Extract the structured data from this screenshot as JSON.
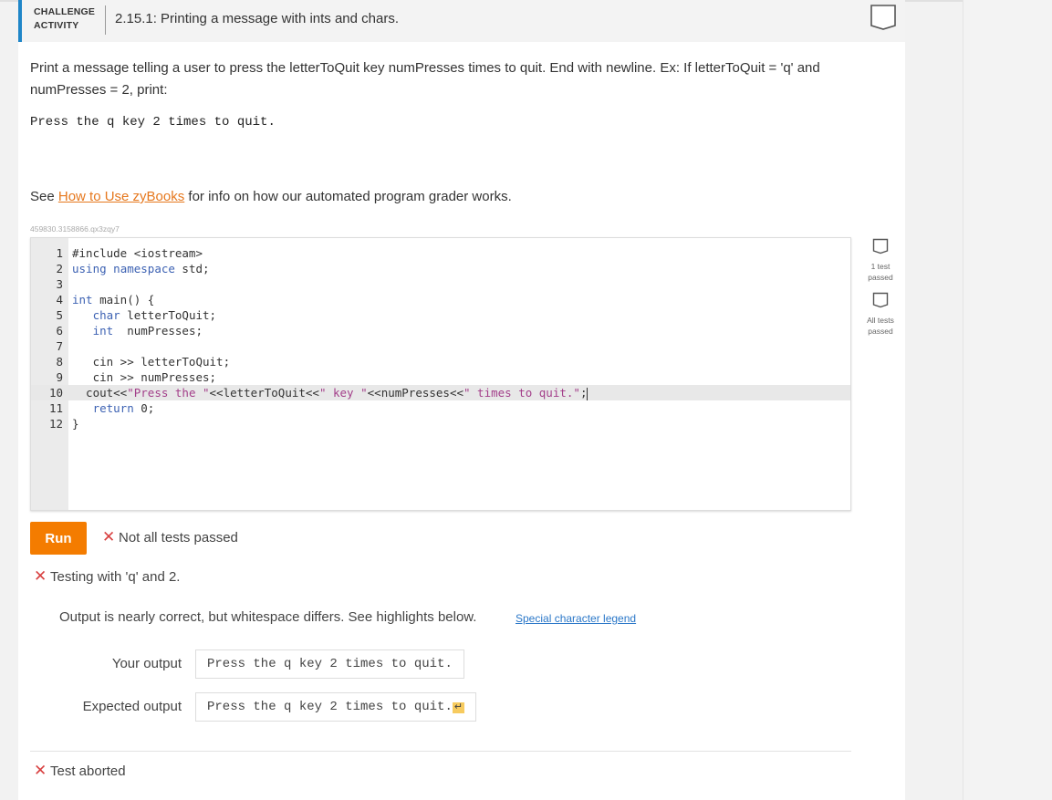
{
  "header": {
    "label_line1": "CHALLENGE",
    "label_line2": "ACTIVITY",
    "title": "2.15.1: Printing a message with ints and chars."
  },
  "prompt": {
    "text_line1": "Print a message telling a user to press the letterToQuit key numPresses times to quit. End with newline. Ex: If letterToQuit = 'q' and",
    "text_line2": "numPresses = 2, print:",
    "example_output": "Press the q key 2 times to quit."
  },
  "help": {
    "prefix": "See ",
    "link_text": "How to Use zyBooks",
    "suffix": " for info on how our automated program grader works."
  },
  "meta_id": "459830.3158866.qx3zqy7",
  "editor": {
    "lines": [
      {
        "n": "1",
        "code": "#include <iostream>"
      },
      {
        "n": "2",
        "code": "using namespace std;"
      },
      {
        "n": "3",
        "code": ""
      },
      {
        "n": "4",
        "code": "int main() {"
      },
      {
        "n": "5",
        "code": "   char letterToQuit;"
      },
      {
        "n": "6",
        "code": "   int  numPresses;"
      },
      {
        "n": "7",
        "code": ""
      },
      {
        "n": "8",
        "code": "   cin >> letterToQuit;"
      },
      {
        "n": "9",
        "code": "   cin >> numPresses;"
      },
      {
        "n": "10",
        "code": "  cout<<\"Press the \"<<letterToQuit<<\" key \"<<numPresses<<\" times to quit.\";"
      },
      {
        "n": "11",
        "code": "   return 0;"
      },
      {
        "n": "12",
        "code": "}"
      }
    ]
  },
  "run_label": "Run",
  "status_text": "Not all tests passed",
  "testing_text": "Testing with 'q' and 2.",
  "diff_message": "Output is nearly correct, but whitespace differs. See highlights below.",
  "legend_link": "Special character legend",
  "your_output": {
    "label": "Your output",
    "value": "Press the q key 2 times to quit."
  },
  "expected_output": {
    "label": "Expected output",
    "value": "Press the q key 2 times to quit.",
    "newline_glyph": "↵"
  },
  "aborted_text": "Test aborted",
  "side": {
    "test1_line1": "1 test",
    "test1_line2": "passed",
    "test2_line1": "All tests",
    "test2_line2": "passed"
  },
  "colors": {
    "accent": "#1f86c8",
    "run": "#f47c00",
    "error": "#d84040",
    "link": "#e6781e"
  }
}
